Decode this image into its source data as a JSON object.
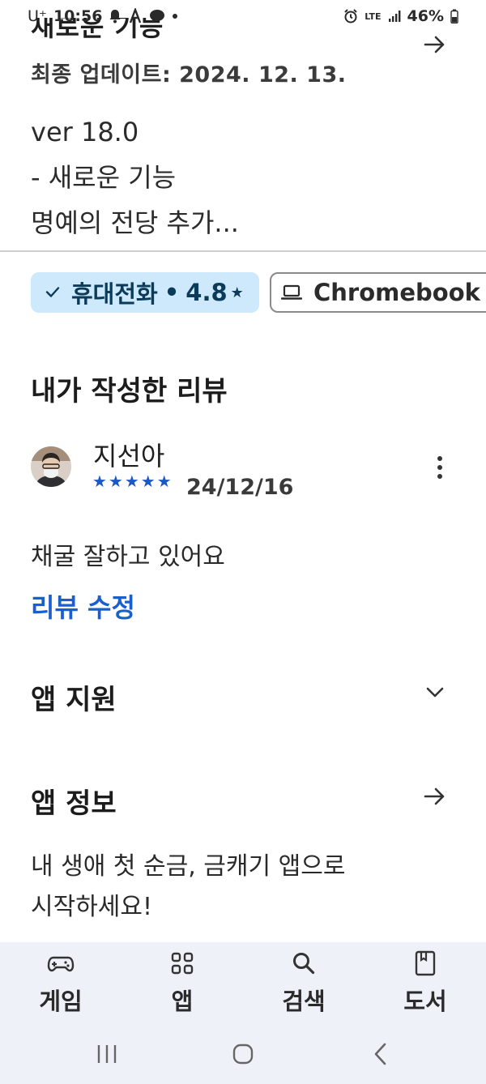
{
  "status_bar": {
    "carrier": "U⁺",
    "time": "10:56",
    "network": "LTE",
    "battery": "46%"
  },
  "whats_new": {
    "title": "새로운 기능",
    "updated": "최종 업데이트: 2024. 12. 13.",
    "notes": [
      "ver 18.0",
      "- 새로운 기능",
      "명예의 전당 추가..."
    ]
  },
  "device_chips": {
    "phone": {
      "label": "휴대전화",
      "separator": "•",
      "rating": "4.8",
      "star": "★",
      "selected": true
    },
    "chromebook": {
      "label": "Chromebook",
      "selected": false
    }
  },
  "my_review": {
    "title": "내가 작성한 리뷰",
    "reviewer": "지선아",
    "stars": "★★★★★",
    "rating": 5,
    "date": "24/12/16",
    "body": "채굴 잘하고 있어요",
    "edit_label": "리뷰 수정"
  },
  "app_support": {
    "title": "앱 지원"
  },
  "app_info": {
    "title": "앱 정보",
    "description": [
      "내 생애 첫 순금, 금캐기 앱으로",
      "시작하세요!"
    ]
  },
  "bottom_nav": {
    "items": [
      {
        "label": "게임",
        "icon": "gamepad-icon"
      },
      {
        "label": "앱",
        "icon": "apps-grid-icon"
      },
      {
        "label": "검색",
        "icon": "search-icon"
      },
      {
        "label": "도서",
        "icon": "book-icon"
      }
    ]
  },
  "colors": {
    "accent_blue": "#1a5fd0",
    "chip_selected_bg": "#cde9fb",
    "nav_bg": "#eef2f8"
  }
}
